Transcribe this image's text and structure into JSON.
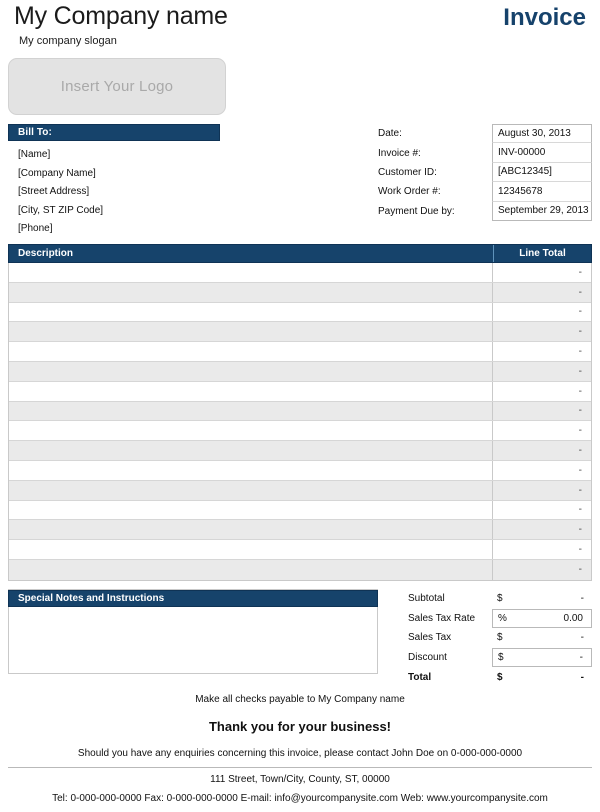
{
  "colors": {
    "brand_navy": "#16436b",
    "brand_navy_dark": "#0f3355",
    "title_navy": "#16426b",
    "row_stripe": "#eaeaea",
    "logo_bg": "#e3e3e3"
  },
  "header": {
    "company_name": "My Company name",
    "company_slogan": "My company slogan",
    "invoice_title": "Invoice",
    "logo_placeholder": "Insert Your Logo"
  },
  "bill_to": {
    "heading": "Bill To:",
    "lines": [
      "[Name]",
      "[Company Name]",
      "[Street Address]",
      "[City, ST  ZIP Code]",
      "[Phone]"
    ]
  },
  "meta": {
    "rows": [
      {
        "label": "Date:",
        "value": "August 30, 2013"
      },
      {
        "label": "Invoice #:",
        "value": "INV-00000"
      },
      {
        "label": "Customer ID:",
        "value": "[ABC12345]"
      },
      {
        "label": "Work Order #:",
        "value": "12345678"
      },
      {
        "label": "Payment Due by:",
        "value": "September 29, 2013"
      }
    ]
  },
  "items": {
    "columns": {
      "description": "Description",
      "line_total": "Line Total"
    },
    "rows": [
      {
        "description": "",
        "line_total": "-"
      },
      {
        "description": "",
        "line_total": "-"
      },
      {
        "description": "",
        "line_total": "-"
      },
      {
        "description": "",
        "line_total": "-"
      },
      {
        "description": "",
        "line_total": "-"
      },
      {
        "description": "",
        "line_total": "-"
      },
      {
        "description": "",
        "line_total": "-"
      },
      {
        "description": "",
        "line_total": "-"
      },
      {
        "description": "",
        "line_total": "-"
      },
      {
        "description": "",
        "line_total": "-"
      },
      {
        "description": "",
        "line_total": "-"
      },
      {
        "description": "",
        "line_total": "-"
      },
      {
        "description": "",
        "line_total": "-"
      },
      {
        "description": "",
        "line_total": "-"
      },
      {
        "description": "",
        "line_total": "-"
      },
      {
        "description": "",
        "line_total": "-"
      }
    ]
  },
  "notes": {
    "heading": "Special Notes and Instructions",
    "body": ""
  },
  "totals": {
    "rows": [
      {
        "label": "Subtotal",
        "currency": "$",
        "value": "-",
        "boxed": false,
        "bold": false
      },
      {
        "label": "Sales Tax Rate",
        "currency": "%",
        "value": "0.00",
        "boxed": true,
        "bold": false
      },
      {
        "label": "Sales Tax",
        "currency": "$",
        "value": "-",
        "boxed": false,
        "bold": false
      },
      {
        "label": "Discount",
        "currency": "$",
        "value": "-",
        "boxed": true,
        "bold": false
      },
      {
        "label": "Total",
        "currency": "$",
        "value": "-",
        "boxed": false,
        "bold": true
      }
    ]
  },
  "footer": {
    "payable_line": "Make all checks payable to My Company name",
    "thanks": "Thank you for your business!",
    "enquiries": "Should you have any enquiries concerning this invoice, please contact John Doe on 0-000-000-0000",
    "address": "111 Street, Town/City, County, ST, 00000",
    "contact": "Tel: 0-000-000-0000 Fax: 0-000-000-0000 E-mail: info@yourcompanysite.com Web: www.yourcompanysite.com"
  }
}
